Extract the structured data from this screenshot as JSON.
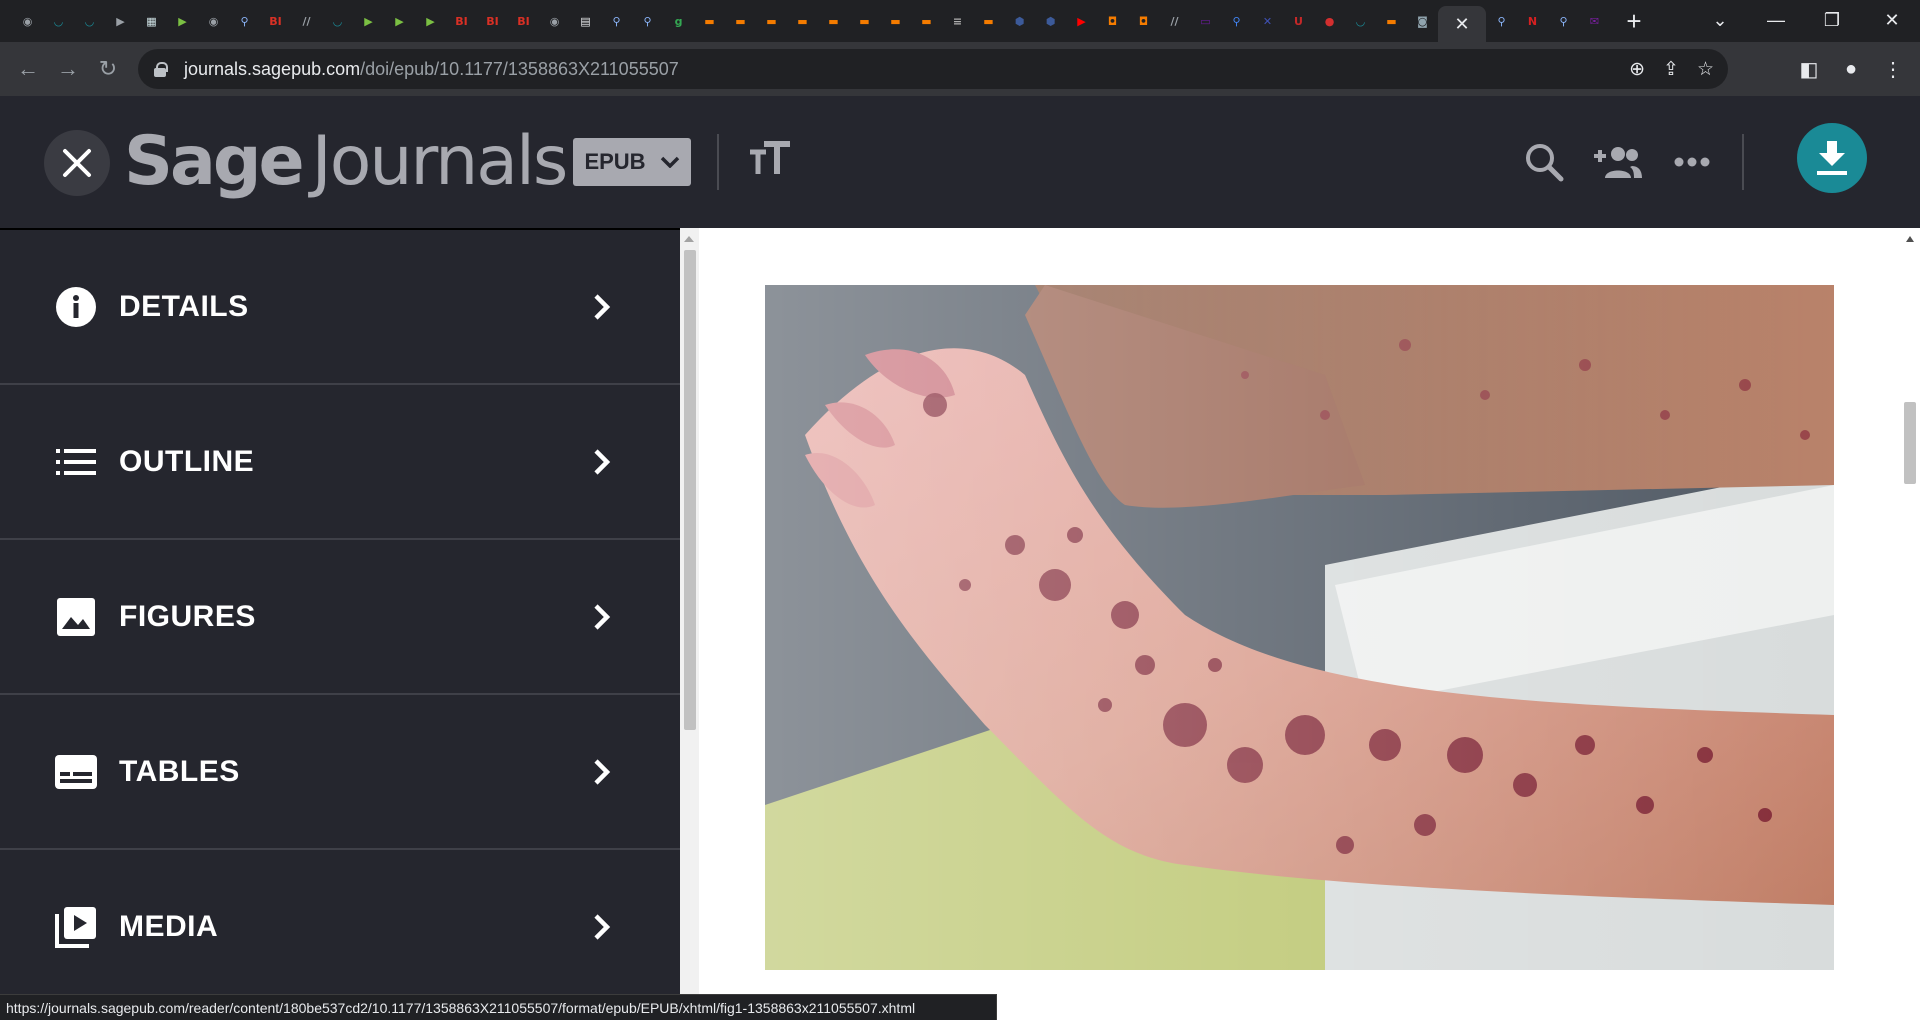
{
  "browser": {
    "tabs": [
      {
        "icon": "globe-icon",
        "color": "#9aa0a6",
        "glyph": "◉"
      },
      {
        "icon": "shield-icon",
        "color": "#1a8a96",
        "glyph": "◡"
      },
      {
        "icon": "shield-icon",
        "color": "#1a8a96",
        "glyph": "◡"
      },
      {
        "icon": "tag-icon",
        "color": "#9aa0a6",
        "glyph": "▶"
      },
      {
        "icon": "puzzle-icon",
        "color": "#cfe3e6",
        "glyph": "▦"
      },
      {
        "icon": "play-icon",
        "color": "#7bc043",
        "glyph": "▶"
      },
      {
        "icon": "globe-icon",
        "color": "#9aa0a6",
        "glyph": "◉"
      },
      {
        "icon": "search-icon",
        "color": "#8ab4f8",
        "glyph": "⚲"
      },
      {
        "icon": "bi-icon",
        "color": "#d93025",
        "glyph": "BI"
      },
      {
        "icon": "text-icon",
        "color": "#9aa0a6",
        "glyph": "//"
      },
      {
        "icon": "shield-icon",
        "color": "#1a8a96",
        "glyph": "◡"
      },
      {
        "icon": "play-icon",
        "color": "#7bc043",
        "glyph": "▶"
      },
      {
        "icon": "play-icon",
        "color": "#7bc043",
        "glyph": "▶"
      },
      {
        "icon": "play-icon",
        "color": "#7bc043",
        "glyph": "▶"
      },
      {
        "icon": "bi-icon",
        "color": "#d93025",
        "glyph": "BI"
      },
      {
        "icon": "bi-icon",
        "color": "#d93025",
        "glyph": "BI"
      },
      {
        "icon": "bi-icon",
        "color": "#d93025",
        "glyph": "BI"
      },
      {
        "icon": "globe-icon",
        "color": "#9aa0a6",
        "glyph": "◉"
      },
      {
        "icon": "news-icon",
        "color": "#e8eaed",
        "glyph": "▤"
      },
      {
        "icon": "search-icon",
        "color": "#8ab4f8",
        "glyph": "⚲"
      },
      {
        "icon": "search-icon",
        "color": "#8ab4f8",
        "glyph": "⚲"
      },
      {
        "icon": "g-icon",
        "color": "#34a853",
        "glyph": "g"
      },
      {
        "icon": "bookmark-icon",
        "color": "#f57c00",
        "glyph": "▬"
      },
      {
        "icon": "bookmark-icon",
        "color": "#f57c00",
        "glyph": "▬"
      },
      {
        "icon": "bookmark-icon",
        "color": "#f57c00",
        "glyph": "▬"
      },
      {
        "icon": "bookmark-icon",
        "color": "#f57c00",
        "glyph": "▬"
      },
      {
        "icon": "bookmark-icon",
        "color": "#f57c00",
        "glyph": "▬"
      },
      {
        "icon": "bookmark-icon",
        "color": "#f57c00",
        "glyph": "▬"
      },
      {
        "icon": "bookmark-icon",
        "color": "#f57c00",
        "glyph": "▬"
      },
      {
        "icon": "bookmark-icon",
        "color": "#f57c00",
        "glyph": "▬"
      },
      {
        "icon": "flag-icon",
        "color": "#b0b0b0",
        "glyph": "≡"
      },
      {
        "icon": "bookmark-icon",
        "color": "#f57c00",
        "glyph": "▬"
      },
      {
        "icon": "hex-icon",
        "color": "#3c5a99",
        "glyph": "⬢"
      },
      {
        "icon": "hex-icon",
        "color": "#3c5a99",
        "glyph": "⬢"
      },
      {
        "icon": "youtube-icon",
        "color": "#ff0000",
        "glyph": "▶"
      },
      {
        "icon": "shield-icon",
        "color": "#f57c00",
        "glyph": "◘"
      },
      {
        "icon": "shield-icon",
        "color": "#f57c00",
        "glyph": "◘"
      },
      {
        "icon": "text-icon",
        "color": "#9aa0a6",
        "glyph": "//"
      },
      {
        "icon": "app-icon",
        "color": "#6a1b9a",
        "glyph": "▭"
      },
      {
        "icon": "search-icon",
        "color": "#4285f4",
        "glyph": "⚲"
      },
      {
        "icon": "crest-icon",
        "color": "#3f51b5",
        "glyph": "✕"
      },
      {
        "icon": "book-icon",
        "color": "#c62828",
        "glyph": "U"
      },
      {
        "icon": "pin-icon",
        "color": "#d32f2f",
        "glyph": "●"
      },
      {
        "icon": "shield-icon",
        "color": "#1a8a96",
        "glyph": "◡"
      },
      {
        "icon": "bookmark-icon",
        "color": "#f57c00",
        "glyph": "▬"
      },
      {
        "icon": "avatar-icon",
        "color": "#90a4ae",
        "glyph": "◙"
      }
    ],
    "tabs_after": [
      {
        "icon": "search-icon",
        "color": "#8ab4f8",
        "glyph": "⚲"
      },
      {
        "icon": "npr-icon",
        "color": "#d62021",
        "glyph": "N"
      },
      {
        "icon": "search-icon",
        "color": "#8ab4f8",
        "glyph": "⚲"
      },
      {
        "icon": "mail-icon",
        "color": "#7b1fa2",
        "glyph": "✉"
      }
    ],
    "address": {
      "host": "journals.sagepub.com",
      "path": "/doi/epub/10.1177/1358863X211055507"
    },
    "status_url": "https://journals.sagepub.com/reader/content/180be537cd2/10.1177/1358863X211055507/format/epub/EPUB/xhtml/fig1-1358863x211055507.xhtml"
  },
  "header": {
    "logo_sage": "Sage",
    "logo_journals": "Journals",
    "format_label": "EPUB",
    "accent": "#1a8a96"
  },
  "sidebar": {
    "items": [
      {
        "label": "DETAILS",
        "icon": "info-icon"
      },
      {
        "label": "OUTLINE",
        "icon": "list-icon"
      },
      {
        "label": "FIGURES",
        "icon": "image-icon"
      },
      {
        "label": "TABLES",
        "icon": "table-icon"
      },
      {
        "label": "MEDIA",
        "icon": "media-icon"
      }
    ]
  }
}
